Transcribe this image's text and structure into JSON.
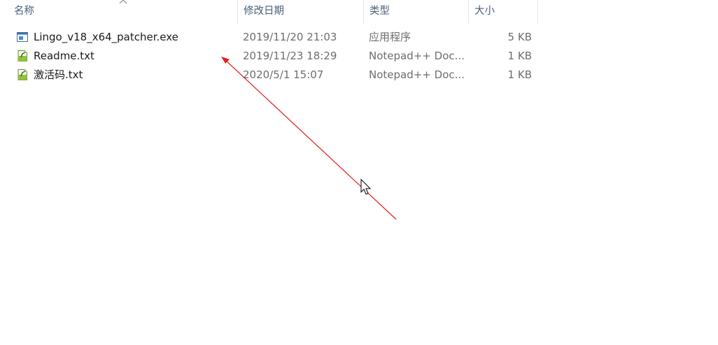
{
  "columns": {
    "name": "名称",
    "date": "修改日期",
    "type": "类型",
    "size": "大小"
  },
  "files": [
    {
      "name": "Lingo_v18_x64_patcher.exe",
      "date": "2019/11/20 21:03",
      "type": "应用程序",
      "size": "5 KB",
      "icon": "exe-file-icon"
    },
    {
      "name": "Readme.txt",
      "date": "2019/11/23 18:29",
      "type": "Notepad++ Doc...",
      "size": "1 KB",
      "icon": "notepadpp-document-icon"
    },
    {
      "name": "激活码.txt",
      "date": "2020/5/1 15:07",
      "type": "Notepad++ Doc...",
      "size": "1 KB",
      "icon": "notepadpp-document-icon"
    }
  ],
  "colors": {
    "header_text": "#4c607a",
    "annotation_arrow": "#e02020"
  }
}
